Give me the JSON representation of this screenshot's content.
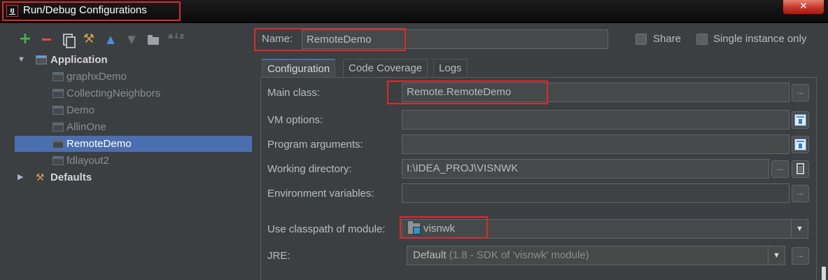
{
  "window": {
    "title": "Run/Debug Configurations",
    "close_glyph": "✕"
  },
  "toolbar": {
    "add_glyph": "+",
    "wrench_glyph": "⚒",
    "up_glyph": "▲",
    "down_glyph": "▼",
    "sort_glyph": "a↓z"
  },
  "tree": {
    "expanded_arrow": "▼",
    "collapsed_arrow": "▶",
    "application": {
      "label": "Application",
      "children": [
        "graphxDemo",
        "CollectingNeighbors",
        "Demo",
        "AllinOne",
        "RemoteDemo",
        "fdlayout2"
      ],
      "selected": "RemoteDemo"
    },
    "defaults": {
      "label": "Defaults"
    }
  },
  "header": {
    "name_label": "Name:",
    "name_value": "RemoteDemo",
    "share_label": "Share",
    "share_checked": false,
    "single_instance_label": "Single instance only",
    "single_instance_checked": false
  },
  "tabs": [
    {
      "label": "Configuration",
      "active": true
    },
    {
      "label": "Code Coverage",
      "active": false
    },
    {
      "label": "Logs",
      "active": false
    }
  ],
  "form": {
    "main_class": {
      "label": "Main class:",
      "value": "Remote.RemoteDemo"
    },
    "vm_options": {
      "label": "VM options:",
      "value": ""
    },
    "program_arguments": {
      "label": "Program arguments:",
      "value": ""
    },
    "working_directory": {
      "label": "Working directory:",
      "value": "I:\\IDEA_PROJ\\VISNWK"
    },
    "environment_variables": {
      "label": "Environment variables:",
      "value": ""
    },
    "classpath_module": {
      "label": "Use classpath of module:",
      "value": "visnwk"
    },
    "jre": {
      "label": "JRE:",
      "value": "Default",
      "detail": "(1.8 - SDK of 'visnwk' module)"
    },
    "ellipsis": "...",
    "dropdown_glyph": "▼"
  }
}
